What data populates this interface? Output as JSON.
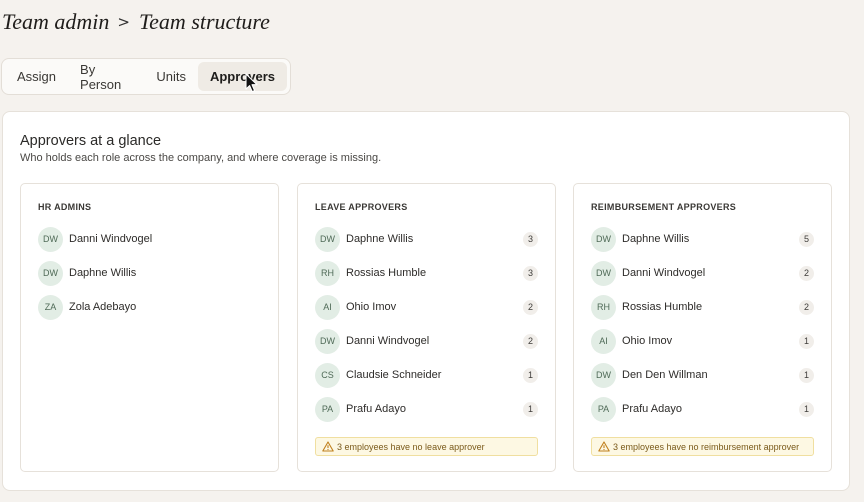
{
  "breadcrumb": {
    "root": "Team admin",
    "separator": ">",
    "current": "Team structure"
  },
  "tabs": [
    {
      "label": "Assign",
      "active": false
    },
    {
      "label": "By Person",
      "active": false
    },
    {
      "label": "Units",
      "active": false
    },
    {
      "label": "Approvers",
      "active": true
    }
  ],
  "panel": {
    "title": "Approvers at a glance",
    "subtitle": "Who holds each role across the company, and where coverage is missing."
  },
  "cards": [
    {
      "title": "HR ADMINS",
      "people": [
        {
          "initials": "DW",
          "name": "Danni Windvogel"
        },
        {
          "initials": "DW",
          "name": "Daphne Willis"
        },
        {
          "initials": "ZA",
          "name": "Zola Adebayo"
        }
      ]
    },
    {
      "title": "LEAVE APPROVERS",
      "people": [
        {
          "initials": "DW",
          "name": "Daphne Willis",
          "count": "3"
        },
        {
          "initials": "RH",
          "name": "Rossias Humble",
          "count": "3"
        },
        {
          "initials": "AI",
          "name": "Ohio Imov",
          "count": "2"
        },
        {
          "initials": "DW",
          "name": "Danni Windvogel",
          "count": "2"
        },
        {
          "initials": "CS",
          "name": "Claudsie Schneider",
          "count": "1"
        },
        {
          "initials": "PA",
          "name": "Prafu Adayo",
          "count": "1"
        }
      ],
      "warning": "3 employees have no leave approver"
    },
    {
      "title": "REIMBURSEMENT APPROVERS",
      "people": [
        {
          "initials": "DW",
          "name": "Daphne Willis",
          "count": "5"
        },
        {
          "initials": "DW",
          "name": "Danni Windvogel",
          "count": "2"
        },
        {
          "initials": "RH",
          "name": "Rossias Humble",
          "count": "2"
        },
        {
          "initials": "AI",
          "name": "Ohio Imov",
          "count": "1"
        },
        {
          "initials": "DW",
          "name": "Den Den Willman",
          "count": "1"
        },
        {
          "initials": "PA",
          "name": "Prafu Adayo",
          "count": "1"
        }
      ],
      "warning": "3 employees have no reimbursement approver"
    }
  ],
  "colors": {
    "background": "#f5f2ee",
    "avatar_bg": "#e2ede5",
    "avatar_text": "#4f6a57",
    "warning_bg": "#fdf8e3",
    "warning_border": "#f0dfa0",
    "warning_text": "#7a5a1a"
  },
  "icons": {
    "warning": "warning-triangle-icon",
    "cursor": "mouse-pointer-icon"
  }
}
